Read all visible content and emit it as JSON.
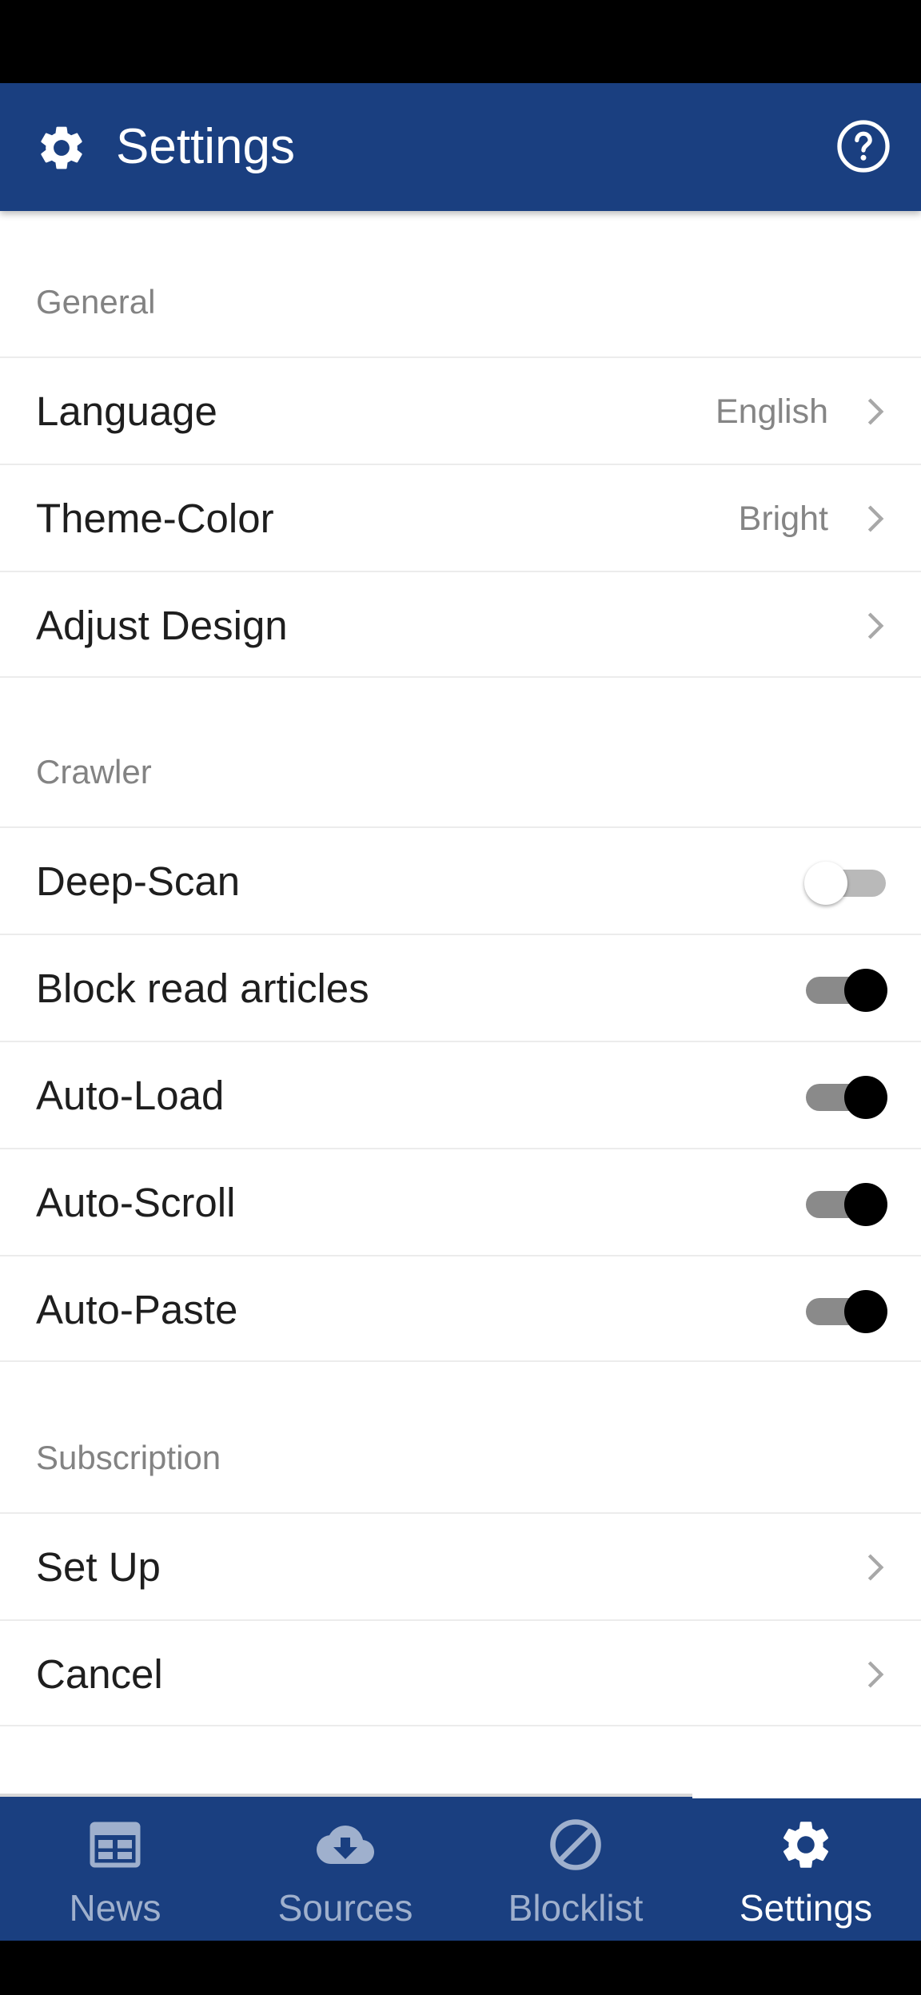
{
  "app_bar": {
    "title": "Settings",
    "icon": "gear-icon",
    "help_icon": "help-icon",
    "background": "#1a3f80"
  },
  "sections": {
    "general": {
      "header": "General",
      "language": {
        "label": "Language",
        "value": "English"
      },
      "theme": {
        "label": "Theme-Color",
        "value": "Bright"
      },
      "design": {
        "label": "Adjust Design"
      }
    },
    "crawler": {
      "header": "Crawler",
      "deep_scan": {
        "label": "Deep-Scan",
        "enabled": false
      },
      "block_read": {
        "label": "Block read articles",
        "enabled": true
      },
      "auto_load": {
        "label": "Auto-Load",
        "enabled": true
      },
      "auto_scroll": {
        "label": "Auto-Scroll",
        "enabled": true
      },
      "auto_paste": {
        "label": "Auto-Paste",
        "enabled": true
      }
    },
    "subscription": {
      "header": "Subscription",
      "set_up": {
        "label": "Set Up"
      },
      "cancel": {
        "label": "Cancel"
      }
    }
  },
  "bottom_nav": {
    "items": [
      {
        "label": "News",
        "icon": "newspaper-icon",
        "active": false
      },
      {
        "label": "Sources",
        "icon": "cloud-download-icon",
        "active": false
      },
      {
        "label": "Blocklist",
        "icon": "block-icon",
        "active": false
      },
      {
        "label": "Settings",
        "icon": "gear-icon",
        "active": true
      }
    ]
  }
}
